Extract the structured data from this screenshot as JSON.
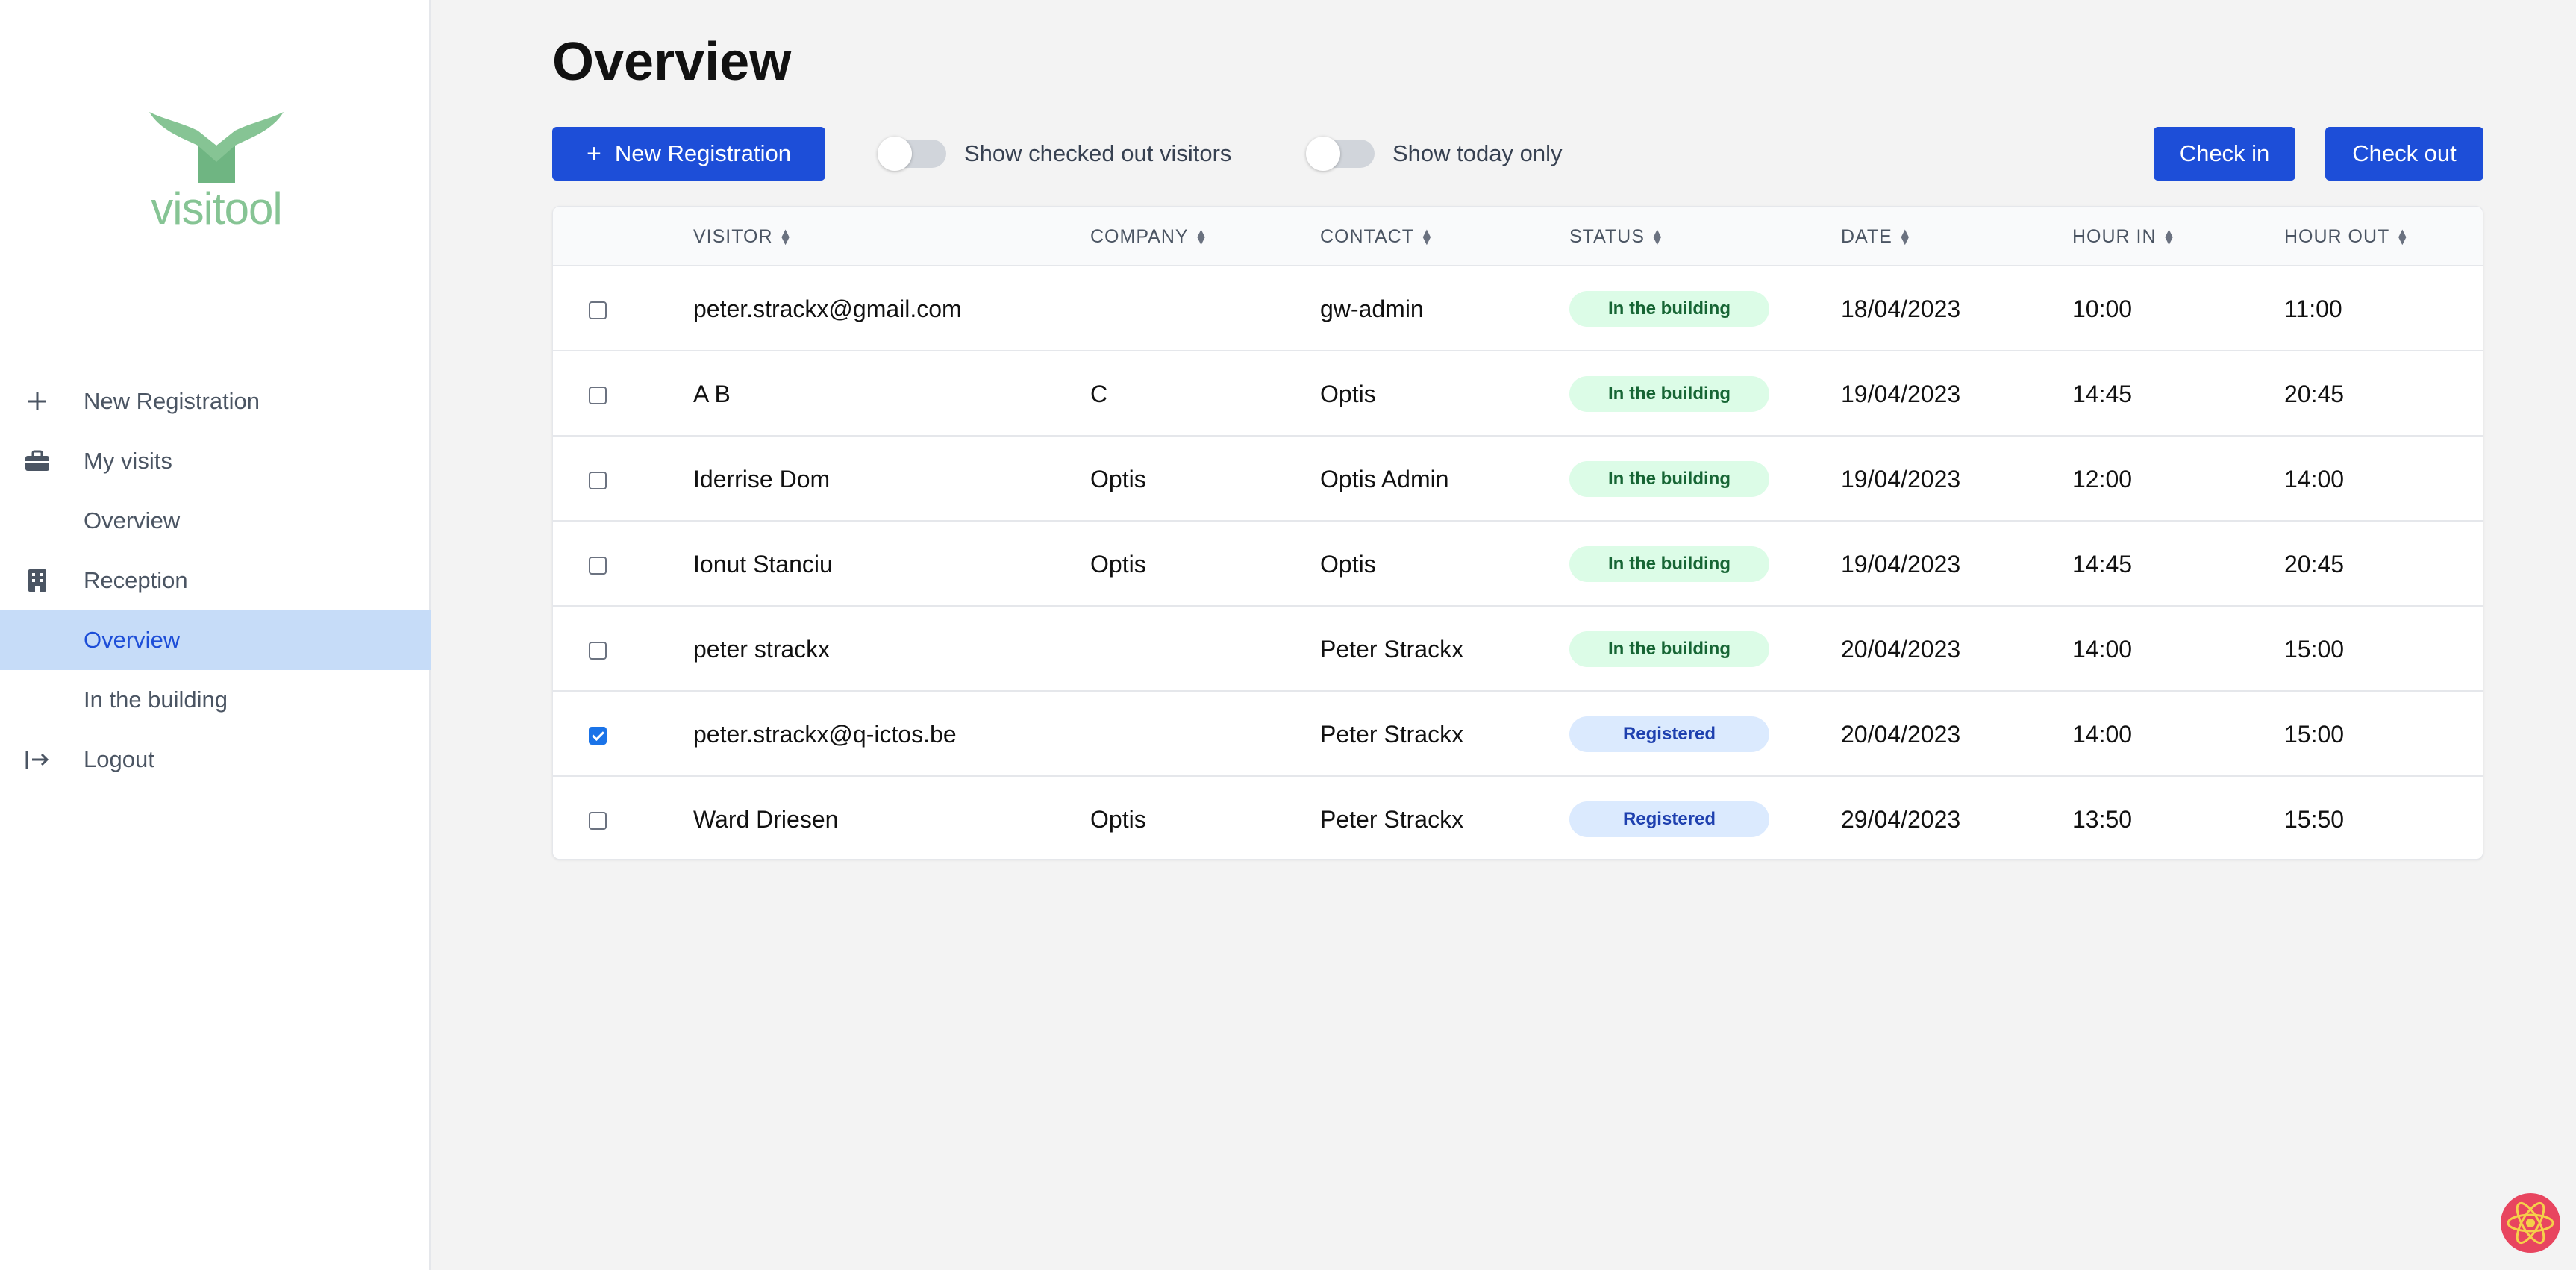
{
  "sidebar": {
    "logo_text": "visitool",
    "items": [
      {
        "label": "New Registration",
        "icon": "plus-icon"
      },
      {
        "label": "My visits",
        "icon": "briefcase-icon"
      },
      {
        "label": "Overview",
        "sub": true
      },
      {
        "label": "Reception",
        "icon": "building-icon"
      },
      {
        "label": "Overview",
        "sub": true,
        "active": true
      },
      {
        "label": "In the building",
        "sub": true
      },
      {
        "label": "Logout",
        "icon": "logout-icon"
      }
    ]
  },
  "page": {
    "title": "Overview"
  },
  "toolbar": {
    "new_registration_label": "New Registration",
    "toggle_checked_out_label": "Show checked out visitors",
    "toggle_today_label": "Show today only",
    "check_in_label": "Check in",
    "check_out_label": "Check out"
  },
  "table": {
    "columns": [
      "VISITOR",
      "COMPANY",
      "CONTACT",
      "STATUS",
      "DATE",
      "HOUR IN",
      "HOUR OUT"
    ],
    "rows": [
      {
        "checked": false,
        "visitor": "peter.strackx@gmail.com",
        "company": "",
        "contact": "gw-admin",
        "status": "In the building",
        "date": "18/04/2023",
        "hour_in": "10:00",
        "hour_out": "11:00"
      },
      {
        "checked": false,
        "visitor": "A B",
        "company": "C",
        "contact": "Optis",
        "status": "In the building",
        "date": "19/04/2023",
        "hour_in": "14:45",
        "hour_out": "20:45"
      },
      {
        "checked": false,
        "visitor": "Iderrise Dom",
        "company": "Optis",
        "contact": "Optis Admin",
        "status": "In the building",
        "date": "19/04/2023",
        "hour_in": "12:00",
        "hour_out": "14:00"
      },
      {
        "checked": false,
        "visitor": "Ionut Stanciu",
        "company": "Optis",
        "contact": "Optis",
        "status": "In the building",
        "date": "19/04/2023",
        "hour_in": "14:45",
        "hour_out": "20:45"
      },
      {
        "checked": false,
        "visitor": "peter strackx",
        "company": "",
        "contact": "Peter Strackx",
        "status": "In the building",
        "date": "20/04/2023",
        "hour_in": "14:00",
        "hour_out": "15:00"
      },
      {
        "checked": true,
        "visitor": "peter.strackx@q-ictos.be",
        "company": "",
        "contact": "Peter Strackx",
        "status": "Registered",
        "date": "20/04/2023",
        "hour_in": "14:00",
        "hour_out": "15:00"
      },
      {
        "checked": false,
        "visitor": "Ward Driesen",
        "company": "Optis",
        "contact": "Peter Strackx",
        "status": "Registered",
        "date": "29/04/2023",
        "hour_in": "13:50",
        "hour_out": "15:50"
      }
    ]
  },
  "colors": {
    "primary": "#1d4ed8",
    "active_nav_bg": "#c6dcf8",
    "badge_green_bg": "#dcfce7",
    "badge_green_text": "#166534",
    "badge_blue_bg": "#dbeafe",
    "badge_blue_text": "#1e40af",
    "logo_green": "#86c494"
  }
}
